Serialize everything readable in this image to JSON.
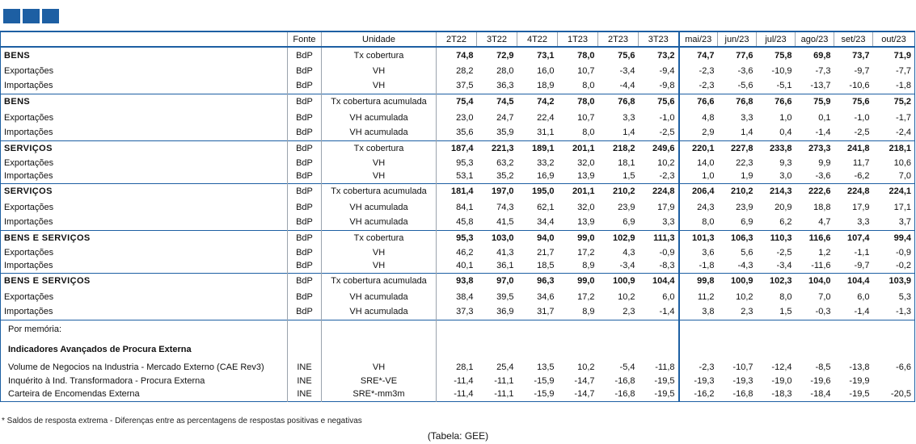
{
  "header": {
    "fonte": "Fonte",
    "unidade": "Unidade",
    "quarters": [
      "2T22",
      "3T22",
      "4T22",
      "1T23",
      "2T23",
      "3T23"
    ],
    "months": [
      "mai/23",
      "jun/23",
      "jul/23",
      "ago/23",
      "set/23",
      "out/23"
    ]
  },
  "sections": [
    {
      "rows": [
        {
          "label": "BENS",
          "src": "BdP",
          "unit": "Tx cobertura",
          "bold": true,
          "values": [
            "74,8",
            "72,9",
            "73,1",
            "78,0",
            "75,6",
            "73,2",
            "74,7",
            "77,6",
            "75,8",
            "69,8",
            "73,7",
            "71,9"
          ]
        },
        {
          "label": "Exportações",
          "src": "BdP",
          "unit": "VH",
          "values": [
            "28,2",
            "28,0",
            "16,0",
            "10,7",
            "-3,4",
            "-9,4",
            "-2,3",
            "-3,6",
            "-10,9",
            "-7,3",
            "-9,7",
            "-7,7"
          ]
        },
        {
          "label": "Importações",
          "src": "BdP",
          "unit": "VH",
          "values": [
            "37,5",
            "36,3",
            "18,9",
            "8,0",
            "-4,4",
            "-9,8",
            "-2,3",
            "-5,6",
            "-5,1",
            "-13,7",
            "-10,6",
            "-1,8"
          ]
        }
      ]
    },
    {
      "rows": [
        {
          "label": "BENS",
          "src": "BdP",
          "unit": "Tx cobertura acumulada",
          "bold": true,
          "values": [
            "75,4",
            "74,5",
            "74,2",
            "78,0",
            "76,8",
            "75,6",
            "76,6",
            "76,8",
            "76,6",
            "75,9",
            "75,6",
            "75,2"
          ]
        },
        {
          "label": "Exportações",
          "src": "BdP",
          "unit": "VH acumulada",
          "values": [
            "23,0",
            "24,7",
            "22,4",
            "10,7",
            "3,3",
            "-1,0",
            "4,8",
            "3,3",
            "1,0",
            "0,1",
            "-1,0",
            "-1,7"
          ]
        },
        {
          "label": "Importações",
          "src": "BdP",
          "unit": "VH acumulada",
          "values": [
            "35,6",
            "35,9",
            "31,1",
            "8,0",
            "1,4",
            "-2,5",
            "2,9",
            "1,4",
            "0,4",
            "-1,4",
            "-2,5",
            "-2,4"
          ]
        }
      ]
    },
    {
      "rows": [
        {
          "label": "SERVIÇOS",
          "src": "BdP",
          "unit": "Tx cobertura",
          "bold": true,
          "values": [
            "187,4",
            "221,3",
            "189,1",
            "201,1",
            "218,2",
            "249,6",
            "220,1",
            "227,8",
            "233,8",
            "273,3",
            "241,8",
            "218,1"
          ]
        },
        {
          "label": "Exportações",
          "src": "BdP",
          "unit": "VH",
          "values": [
            "95,3",
            "63,2",
            "33,2",
            "32,0",
            "18,1",
            "10,2",
            "14,0",
            "22,3",
            "9,3",
            "9,9",
            "11,7",
            "10,6"
          ]
        },
        {
          "label": "Importações",
          "src": "BdP",
          "unit": "VH",
          "values": [
            "53,1",
            "35,2",
            "16,9",
            "13,9",
            "1,5",
            "-2,3",
            "1,0",
            "1,9",
            "3,0",
            "-3,6",
            "-6,2",
            "7,0"
          ]
        }
      ]
    },
    {
      "rows": [
        {
          "label": "SERVIÇOS",
          "src": "BdP",
          "unit": "Tx cobertura acumulada",
          "bold": true,
          "values": [
            "181,4",
            "197,0",
            "195,0",
            "201,1",
            "210,2",
            "224,8",
            "206,4",
            "210,2",
            "214,3",
            "222,6",
            "224,8",
            "224,1"
          ]
        },
        {
          "label": "Exportações",
          "src": "BdP",
          "unit": "VH acumulada",
          "values": [
            "84,1",
            "74,3",
            "62,1",
            "32,0",
            "23,9",
            "17,9",
            "24,3",
            "23,9",
            "20,9",
            "18,8",
            "17,9",
            "17,1"
          ]
        },
        {
          "label": "Importações",
          "src": "BdP",
          "unit": "VH acumulada",
          "values": [
            "45,8",
            "41,5",
            "34,4",
            "13,9",
            "6,9",
            "3,3",
            "8,0",
            "6,9",
            "6,2",
            "4,7",
            "3,3",
            "3,7"
          ]
        }
      ]
    },
    {
      "rows": [
        {
          "label": "BENS E SERVIÇOS",
          "src": "BdP",
          "unit": "Tx cobertura",
          "bold": true,
          "values": [
            "95,3",
            "103,0",
            "94,0",
            "99,0",
            "102,9",
            "111,3",
            "101,3",
            "106,3",
            "110,3",
            "116,6",
            "107,4",
            "99,4"
          ]
        },
        {
          "label": "Exportações",
          "src": "BdP",
          "unit": "VH",
          "values": [
            "46,2",
            "41,3",
            "21,7",
            "17,2",
            "4,3",
            "-0,9",
            "3,6",
            "5,6",
            "-2,5",
            "1,2",
            "-1,1",
            "-0,9"
          ]
        },
        {
          "label": "Importações",
          "src": "BdP",
          "unit": "VH",
          "values": [
            "40,1",
            "36,1",
            "18,5",
            "8,9",
            "-3,4",
            "-8,3",
            "-1,8",
            "-4,3",
            "-3,4",
            "-11,6",
            "-9,7",
            "-0,2"
          ]
        }
      ]
    },
    {
      "rows": [
        {
          "label": "BENS E SERVIÇOS",
          "src": "BdP",
          "unit": "Tx cobertura acumulada",
          "bold": true,
          "values": [
            "93,8",
            "97,0",
            "96,3",
            "99,0",
            "100,9",
            "104,4",
            "99,8",
            "100,9",
            "102,3",
            "104,0",
            "104,4",
            "103,9"
          ]
        },
        {
          "label": "Exportações",
          "src": "BdP",
          "unit": "VH acumulada",
          "values": [
            "38,4",
            "39,5",
            "34,6",
            "17,2",
            "10,2",
            "6,0",
            "11,2",
            "10,2",
            "8,0",
            "7,0",
            "6,0",
            "5,3"
          ]
        },
        {
          "label": "Importações",
          "src": "BdP",
          "unit": "VH acumulada",
          "values": [
            "37,3",
            "36,9",
            "31,7",
            "8,9",
            "2,3",
            "-1,4",
            "3,8",
            "2,3",
            "1,5",
            "-0,3",
            "-1,4",
            "-1,3"
          ]
        }
      ]
    }
  ],
  "memo": {
    "label": "Por memória:",
    "title": "Indicadores Avançados de Procura Externa",
    "rows": [
      {
        "label": "Volume de Negocios na Industria - Mercado Externo (CAE Rev3)",
        "src": "INE",
        "unit": "VH",
        "values": [
          "28,1",
          "25,4",
          "13,5",
          "10,2",
          "-5,4",
          "-11,8",
          "-2,3",
          "-10,7",
          "-12,4",
          "-8,5",
          "-13,8",
          "-6,6"
        ]
      },
      {
        "label": "Inquérito à Ind. Transformadora - Procura Externa",
        "src": "INE",
        "unit": "SRE*-VE",
        "values": [
          "-11,4",
          "-11,1",
          "-15,9",
          "-14,7",
          "-16,8",
          "-19,5",
          "-19,3",
          "-19,3",
          "-19,0",
          "-19,6",
          "-19,9",
          ""
        ]
      },
      {
        "label": "Carteira de Encomendas Externa",
        "src": "INE",
        "unit": "SRE*-mm3m",
        "values": [
          "-11,4",
          "-11,1",
          "-15,9",
          "-14,7",
          "-16,8",
          "-19,5",
          "-16,2",
          "-16,8",
          "-18,3",
          "-18,4",
          "-19,5",
          "-20,5"
        ]
      }
    ]
  },
  "footnote": "* Saldos de resposta extrema - Diferenças entre as percentagens de respostas positivas e negativas",
  "caption": "(Tabela: GEE)",
  "colors": {
    "accent": "#1d5fa3",
    "grid": "#9aa3ad"
  },
  "icons": {
    "logo": "gee-logo-squares"
  }
}
